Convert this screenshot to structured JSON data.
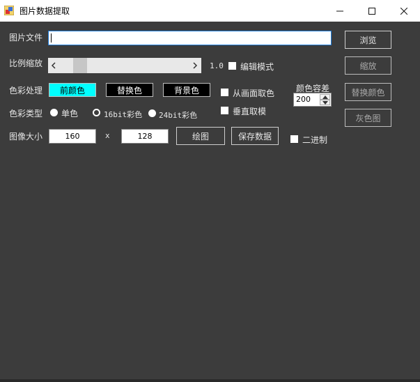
{
  "window": {
    "title": "图片数据提取"
  },
  "file": {
    "label": "图片文件",
    "value": "",
    "browse_label": "浏览"
  },
  "scale": {
    "label": "比例缩放",
    "value_text": "1.0",
    "edit_mode_label": "编辑模式",
    "zoom_label": "缩放",
    "position": 0.12
  },
  "color_process": {
    "label": "色彩处理",
    "foreground_label": "前颜色",
    "foreground_color": "#00ffff",
    "replace_label": "替换色",
    "replace_color": "#000000",
    "background_label": "背景色",
    "background_color": "#000000",
    "pick_from_screen_label": "从画面取色",
    "vertical_mode_label": "垂直取模",
    "tolerance_label": "颜色容差",
    "tolerance_value": "200",
    "replace_color_button": "替换颜色",
    "grayscale_button": "灰色图"
  },
  "color_type": {
    "label": "色彩类型",
    "options": [
      "单色",
      "16bit彩色",
      "24bit彩色"
    ],
    "selected": "16bit彩色"
  },
  "image_size": {
    "label": "图像大小",
    "width": "160",
    "separator": "x",
    "height": "128",
    "draw_label": "绘图",
    "save_label": "保存数据",
    "binary_label": "二进制"
  }
}
